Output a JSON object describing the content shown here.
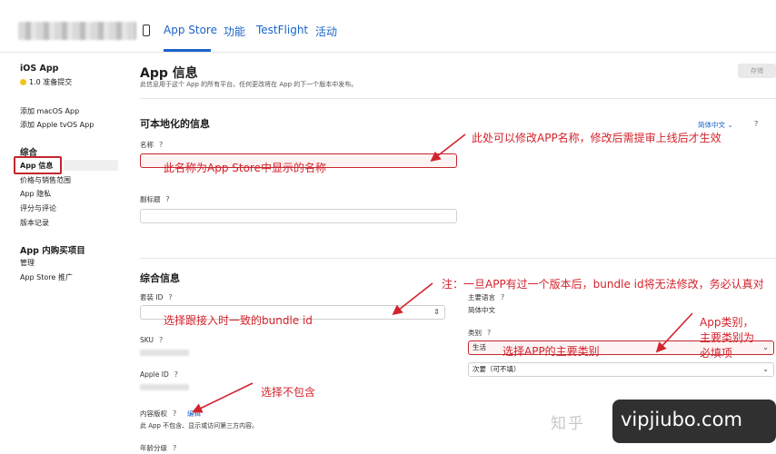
{
  "topbar": {
    "tabs": [
      {
        "label": "App Store",
        "active": true
      },
      {
        "label": "功能"
      },
      {
        "label": "TestFlight"
      },
      {
        "label": "活动"
      }
    ]
  },
  "sidebar": {
    "platform": "iOS App",
    "status": "1.0 准备提交",
    "add_macos": "添加 macOS App",
    "add_tvos": "添加 Apple tvOS App",
    "general_heading": "综合",
    "items": [
      "App 信息",
      "价格与销售范围",
      "App 隐私",
      "评分与评论",
      "版本记录"
    ],
    "iap_heading": "App 内购买项目",
    "iap_items": [
      "管理",
      "App Store 推广"
    ]
  },
  "main": {
    "title": "App 信息",
    "subtitle": "此信息用于这个 App 的所有平台。任何更改将在 App 的下一个版本中发布。",
    "save_label": "存储",
    "localizable": {
      "heading": "可本地化的信息",
      "language": "简体中文",
      "name_label": "名称",
      "subtitle_label": "副标题"
    },
    "general": {
      "heading": "综合信息",
      "bundle_label": "套装 ID",
      "sku_label": "SKU",
      "appleid_label": "Apple ID",
      "rights_label": "内容版权",
      "rights_edit": "编辑",
      "rights_desc": "此 App 不包含、显示或访问第三方内容。",
      "age_label": "年龄分级",
      "primary_lang_label": "主要语言",
      "primary_lang_value": "简体中文",
      "category_label": "类别",
      "category_primary": "生活",
      "category_secondary": "次要（可不填）"
    }
  },
  "annotations": {
    "name_hint": "此处可以修改APP名称，修改后需提审上线后才生效",
    "name_field": "此名称为App Store中显示的名称",
    "bundle_note": "注：一旦APP有过一个版本后，bundle id将无法修改，务必认真对",
    "bundle_select": "选择跟接入时一致的bundle id",
    "category_note_1": "App类别，",
    "category_note_2": "主要类别为",
    "category_note_3": "必填项",
    "category_select": "选择APP的主要类别",
    "rights_note": "选择不包含"
  },
  "watermark": {
    "zhihu": "知乎",
    "site": "vipjiubo.com"
  },
  "colors": {
    "accent": "#1a64c9",
    "annotation": "#d3232c"
  }
}
